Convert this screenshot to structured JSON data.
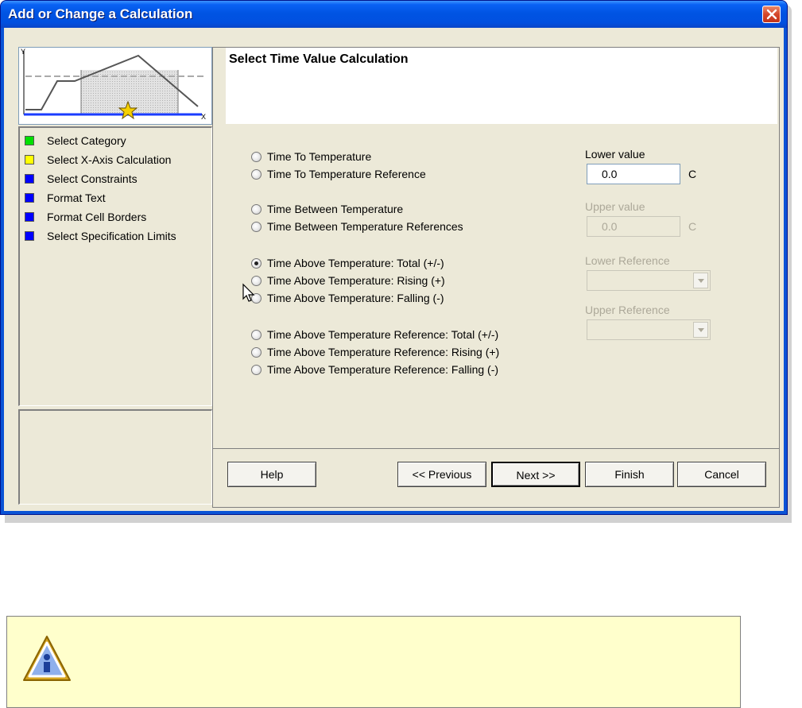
{
  "window": {
    "title": "Add or Change a Calculation"
  },
  "preview": {
    "y_axis_label": "Y",
    "x_axis_label": "X"
  },
  "steps": [
    {
      "label": "Select Category",
      "color": "#00e000"
    },
    {
      "label": "Select X-Axis Calculation",
      "color": "#ffff00"
    },
    {
      "label": "Select Constraints",
      "color": "#0000ff"
    },
    {
      "label": "Format Text",
      "color": "#0000ff"
    },
    {
      "label": "Format Cell Borders",
      "color": "#0000ff"
    },
    {
      "label": "Select Specification Limits",
      "color": "#0000ff"
    }
  ],
  "header": {
    "title": "Select Time Value Calculation"
  },
  "options": [
    {
      "label": "Time To Temperature",
      "checked": false
    },
    {
      "label": "Time To Temperature Reference",
      "checked": false
    },
    {
      "label": "Time Between Temperature",
      "checked": false
    },
    {
      "label": "Time Between Temperature References",
      "checked": false
    },
    {
      "label": "Time Above Temperature: Total (+/-)",
      "checked": true
    },
    {
      "label": "Time Above Temperature: Rising (+)",
      "checked": false
    },
    {
      "label": "Time Above Temperature: Falling (-)",
      "checked": false
    },
    {
      "label": "Time Above Temperature Reference: Total (+/-)",
      "checked": false
    },
    {
      "label": "Time Above Temperature Reference: Rising (+)",
      "checked": false
    },
    {
      "label": "Time Above Temperature Reference: Falling (-)",
      "checked": false
    }
  ],
  "fields": {
    "lower_value_label": "Lower value",
    "lower_value": "0.0",
    "lower_unit": "C",
    "upper_value_label": "Upper value",
    "upper_value": "0.0",
    "upper_unit": "C",
    "lower_reference_label": "Lower Reference",
    "lower_reference_value": "",
    "upper_reference_label": "Upper Reference",
    "upper_reference_value": ""
  },
  "buttons": {
    "help": "Help",
    "previous": "<< Previous",
    "next": "Next >>",
    "finish": "Finish",
    "cancel": "Cancel"
  },
  "note": {
    "icon": "info-icon",
    "text": ""
  }
}
